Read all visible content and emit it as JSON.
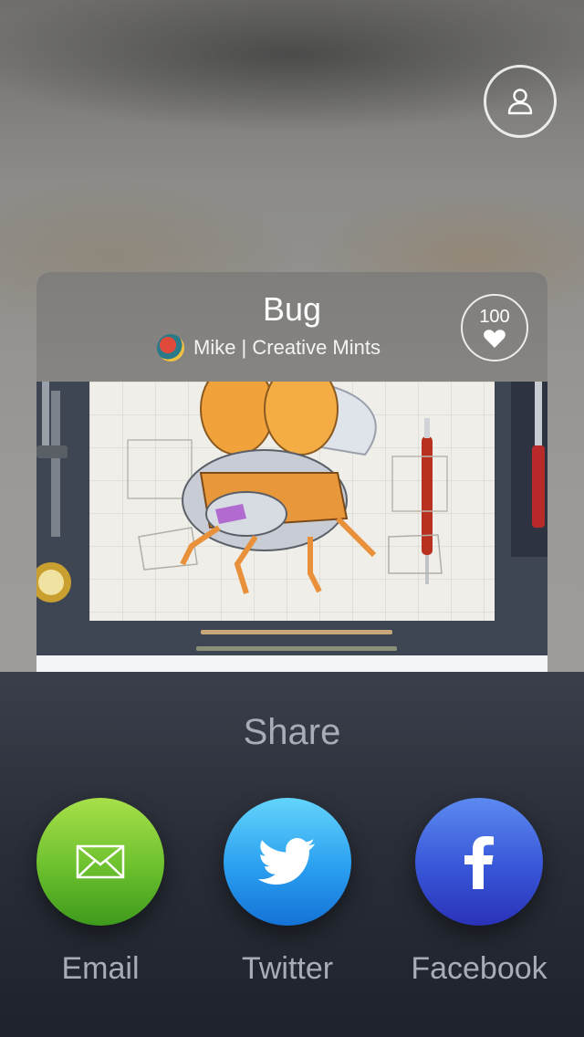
{
  "card": {
    "title": "Bug",
    "author": "Mike | Creative Mints",
    "likes": "100"
  },
  "share": {
    "title": "Share",
    "options": [
      {
        "label": "Email",
        "icon": "envelope-icon",
        "color": "#6cc02e"
      },
      {
        "label": "Twitter",
        "icon": "twitter-bird-icon",
        "color": "#2a9ff0"
      },
      {
        "label": "Facebook",
        "icon": "facebook-f-icon",
        "color": "#3856d8"
      }
    ]
  },
  "header": {
    "profile_icon": "user-icon"
  }
}
